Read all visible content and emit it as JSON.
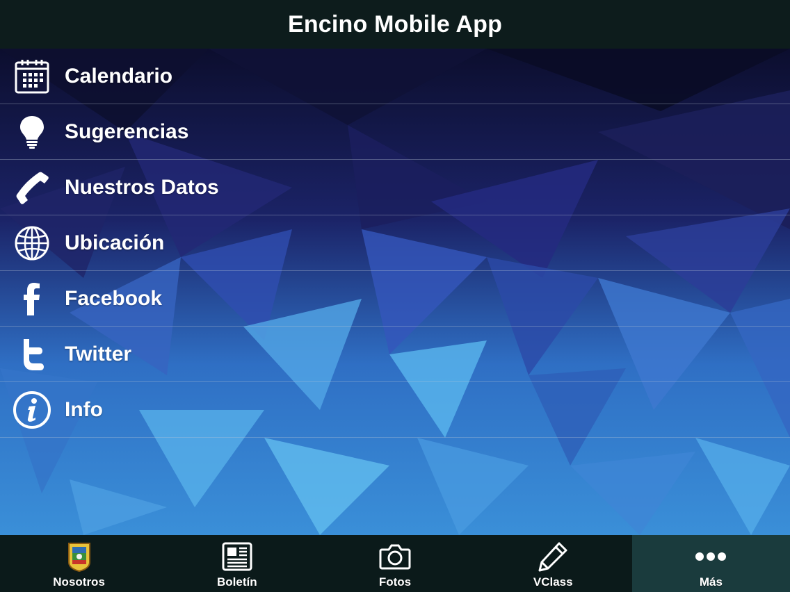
{
  "header": {
    "title": "Encino Mobile App"
  },
  "menu": {
    "items": [
      {
        "label": "Calendario",
        "icon": "calendar-icon"
      },
      {
        "label": "Sugerencias",
        "icon": "lightbulb-icon"
      },
      {
        "label": "Nuestros Datos",
        "icon": "phone-icon"
      },
      {
        "label": "Ubicación",
        "icon": "globe-icon"
      },
      {
        "label": "Facebook",
        "icon": "facebook-icon"
      },
      {
        "label": "Twitter",
        "icon": "twitter-icon"
      },
      {
        "label": "Info",
        "icon": "info-icon"
      }
    ]
  },
  "tabbar": {
    "tabs": [
      {
        "label": "Nosotros",
        "icon": "school-crest-icon",
        "active": false
      },
      {
        "label": "Boletín",
        "icon": "newspaper-icon",
        "active": false
      },
      {
        "label": "Fotos",
        "icon": "camera-icon",
        "active": false
      },
      {
        "label": "VClass",
        "icon": "pencil-icon",
        "active": false
      },
      {
        "label": "Más",
        "icon": "more-dots-icon",
        "active": true
      }
    ]
  },
  "colors": {
    "header_bg": "#0d1c1c",
    "tabbar_bg": "#0b1a1a",
    "tab_active_bg": "#1a3b3d",
    "text": "#ffffff"
  }
}
